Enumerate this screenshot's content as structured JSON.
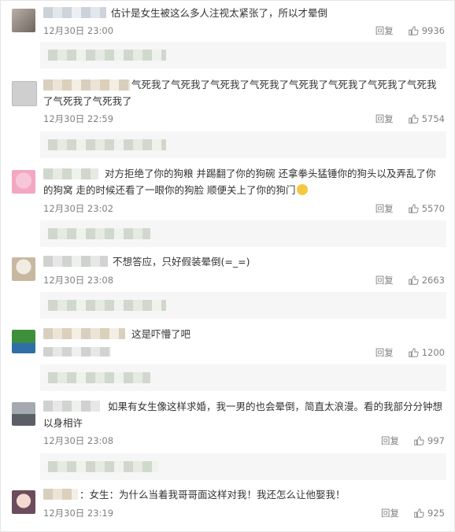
{
  "comments": [
    {
      "text": "估计是女生被这么多人注视太紧张了，所以才晕倒",
      "time": "12月30日 23:00",
      "reply_label": "回复",
      "likes": "9936"
    },
    {
      "text": "气死我了气死我了气死我了气死我了气死我了气死我了气死我了气死我了气死我了气死我了",
      "time": "12月30日 22:59",
      "reply_label": "回复",
      "likes": "5754"
    },
    {
      "text": "对方拒绝了你的狗粮 并踢翻了你的狗碗 还拿拳头猛锤你的狗头以及弄乱了你的狗窝 走的时候还看了一眼你的狗脸 顺便关上了你的狗门",
      "time": "12月30日 23:02",
      "reply_label": "回复",
      "likes": "5570"
    },
    {
      "text": "不想答应，只好假装晕倒(=_=)",
      "time": "12月30日 23:08",
      "reply_label": "回复",
      "likes": "2663"
    },
    {
      "text": "这是吓懵了吧",
      "time": "",
      "reply_label": "回复",
      "likes": "1200"
    },
    {
      "text": "如果有女生像这样求婚，我一男的也会晕倒，简直太浪漫。看的我部分分钟想以身相许",
      "time": "12月30日 23:08",
      "reply_label": "回复",
      "likes": "997"
    },
    {
      "text": "：女生：为什么当着我哥哥面这样对我！我还怎么让他娶我！",
      "time": "12月30日 23:19",
      "reply_label": "回复",
      "likes": "925"
    }
  ],
  "icons": {
    "like": "thumbs-up-icon",
    "emoji": "wink-face-icon"
  },
  "colors": {
    "meta_text": "#808080",
    "reply_bar": "#f6f6f6",
    "comment_text": "#333333"
  }
}
